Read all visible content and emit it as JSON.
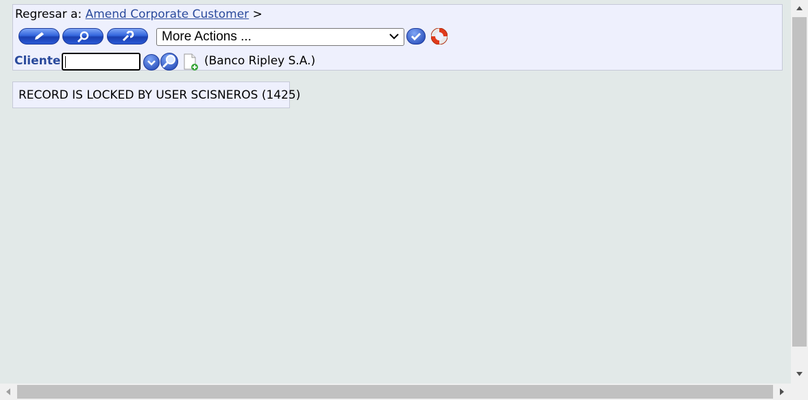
{
  "breadcrumb": {
    "prefix": "Regresar a:",
    "link": "Amend Corporate Customer",
    "separator": ">"
  },
  "toolbar": {
    "more_actions": "More Actions ..."
  },
  "form": {
    "cliente_label": "Cliente",
    "cliente_value": "",
    "cliente_description": "(Banco Ripley S.A.)"
  },
  "message": {
    "text": "RECORD IS LOCKED BY USER SCISNEROS (1425)"
  },
  "colors": {
    "background": "#e2e9e8",
    "panel": "#eef0fd",
    "link": "#2a4a9c",
    "button_blue": "#3366dd"
  }
}
